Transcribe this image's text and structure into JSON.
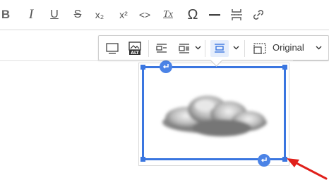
{
  "toolbar": {
    "buttons": [
      {
        "name": "bold-icon",
        "glyph": "B"
      },
      {
        "name": "italic-icon",
        "glyph": "I"
      },
      {
        "name": "underline-icon",
        "glyph": "U"
      },
      {
        "name": "strikethrough-icon",
        "glyph": "S"
      },
      {
        "name": "subscript-icon",
        "glyph": "x₂"
      },
      {
        "name": "superscript-icon",
        "glyph": "x²"
      },
      {
        "name": "code-icon",
        "glyph": "<>"
      },
      {
        "name": "remove-format-icon",
        "glyph": "Tx"
      },
      {
        "name": "special-characters-icon",
        "glyph": "Ω"
      },
      {
        "name": "horizontal-line-icon",
        "glyph": "—"
      },
      {
        "name": "page-break-icon",
        "glyph": "page-break"
      },
      {
        "name": "link-icon",
        "glyph": "link"
      }
    ]
  },
  "image_toolbar": {
    "size_label": "Original",
    "buttons": [
      "toggle-caption-icon",
      "alt-text-icon",
      "wrap-text-left-icon",
      "break-text-left-icon",
      "center-image-icon",
      "resize-image-icon"
    ]
  },
  "colors": {
    "accent": "#3a76e0",
    "active_bg": "#e6eefc",
    "arrow": "#e0201b"
  }
}
